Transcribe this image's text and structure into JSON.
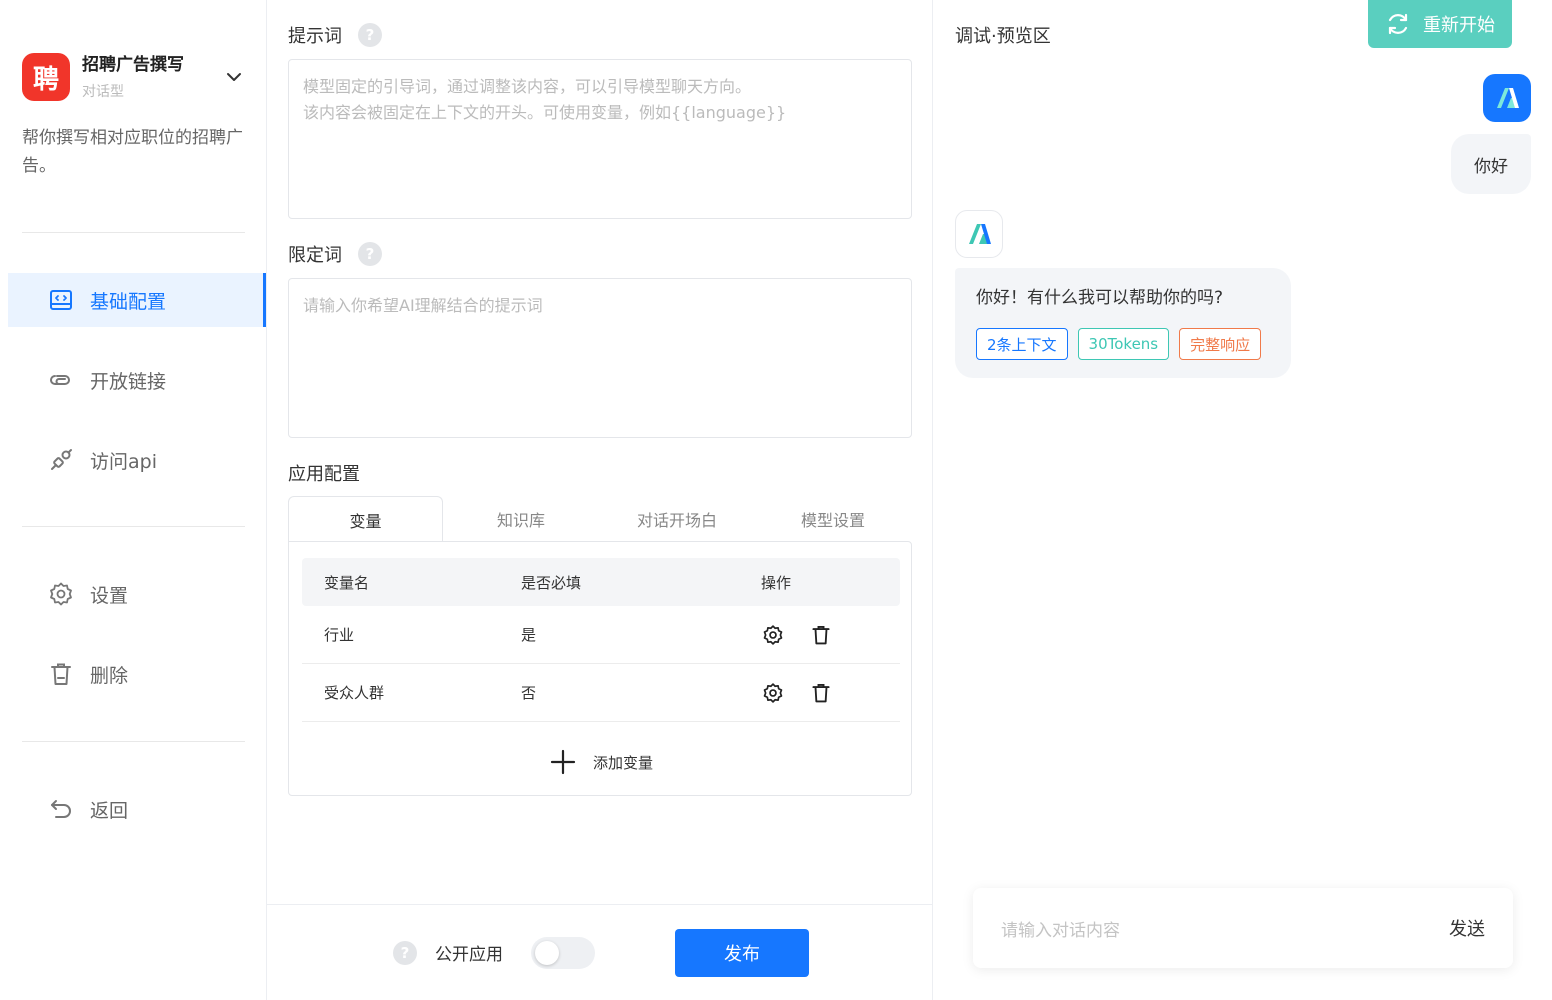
{
  "app": {
    "logo_char": "聘",
    "name": "招聘广告撰写",
    "type": "对话型",
    "description": "帮你撰写相对应职位的招聘广告。"
  },
  "nav": {
    "items": [
      {
        "label": "基础配置",
        "icon": "id-card-icon",
        "active": true
      },
      {
        "label": "开放链接",
        "icon": "link-icon",
        "active": false
      },
      {
        "label": "访问api",
        "icon": "api-plug-icon",
        "active": false
      },
      {
        "label": "设置",
        "icon": "gear-icon",
        "active": false
      },
      {
        "label": "删除",
        "icon": "trash-icon",
        "active": false
      },
      {
        "label": "返回",
        "icon": "back-arrow-icon",
        "active": false
      }
    ]
  },
  "config": {
    "prompt": {
      "title": "提示词",
      "placeholder_line1": "模型固定的引导词，通过调整该内容，可以引导模型聊天方向。",
      "placeholder_line2": "该内容会被固定在上下文的开头。可使用变量，例如{{language}}"
    },
    "limit": {
      "title": "限定词",
      "placeholder": "请输入你希望AI理解结合的提示词"
    },
    "app_config_title": "应用配置",
    "tabs": [
      "变量",
      "知识库",
      "对话开场白",
      "模型设置"
    ],
    "variables": {
      "headers": [
        "变量名",
        "是否必填",
        "操作"
      ],
      "rows": [
        {
          "name": "行业",
          "required": "是"
        },
        {
          "name": "受众人群",
          "required": "否"
        }
      ],
      "add_label": "添加变量"
    }
  },
  "footer": {
    "public_label": "公开应用",
    "public_enabled": false,
    "publish_label": "发布"
  },
  "preview": {
    "title": "调试·预览区",
    "restart_label": "重新开始",
    "user_message": "你好",
    "bot_message": "你好！有什么我可以帮助你的吗?",
    "tags": [
      {
        "label": "2条上下文",
        "color": "#1677ff"
      },
      {
        "label": "30Tokens",
        "color": "#3ec7b4"
      },
      {
        "label": "完整响应",
        "color": "#f07a4a"
      }
    ],
    "input_placeholder": "请输入对话内容",
    "send_label": "发送"
  },
  "colors": {
    "primary": "#1677ff",
    "accent_teal": "#3ec7b4",
    "logo_red": "#f1352a"
  }
}
